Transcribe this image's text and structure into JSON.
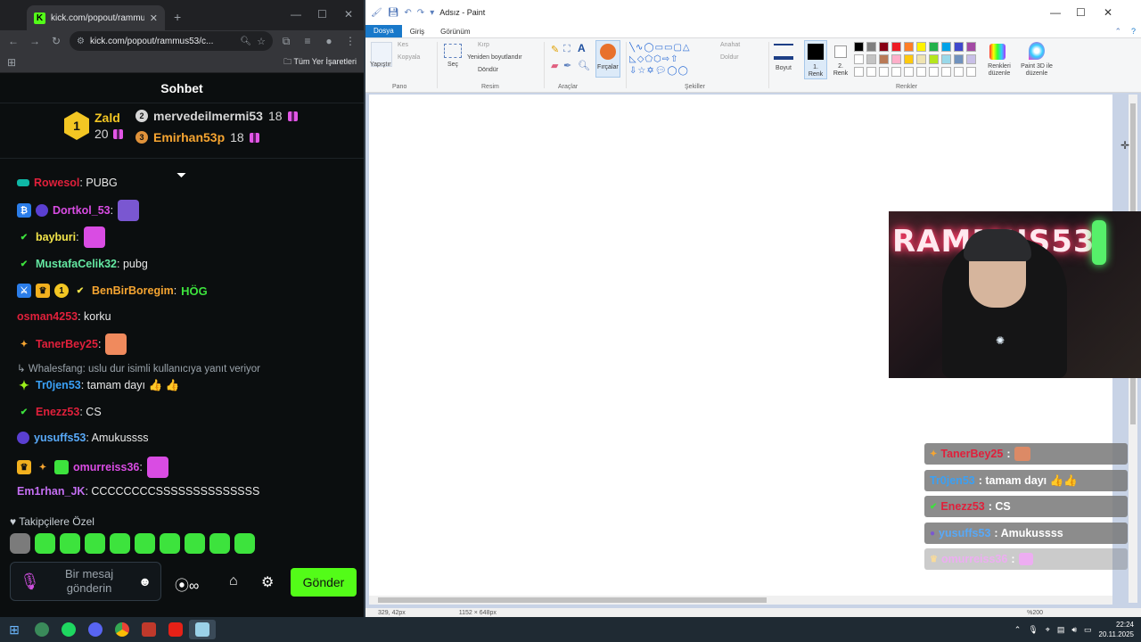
{
  "browser": {
    "tab_title": "kick.com/popout/rammus53/c",
    "url": "kick.com/popout/rammus53/c...",
    "bookmarks_label": "Tüm Yer İşaretleri"
  },
  "chat": {
    "header": "Sohbet",
    "leaderboard": {
      "first": {
        "rank": "1",
        "name": "Zald",
        "count": "20"
      },
      "second": {
        "rank": "2",
        "name": "mervedeilmermi53",
        "count": "18"
      },
      "third": {
        "rank": "3",
        "name": "Emirhan53p",
        "count": "18"
      }
    },
    "messages": [
      {
        "user": "Rowesol",
        "text": ": PUBG",
        "color": "#e0203b"
      },
      {
        "user": "Dortkol_53",
        "text": ":",
        "color": "#d94ce3"
      },
      {
        "user": "bayburi",
        "text": ":",
        "color": "#f2e44a"
      },
      {
        "user": "MustafaCelik32",
        "text": ": pubg",
        "color": "#64e8a2"
      },
      {
        "user": "BenBirBoregim",
        "text": ":",
        "color": "#f6a531"
      },
      {
        "user": "osman4253",
        "text": ": korku",
        "color": "#e0203b"
      },
      {
        "user": "TanerBey25",
        "text": ":",
        "color": "#e0203b"
      },
      {
        "user": "Tr0jen53",
        "text": ": tamam dayı 👍 👍",
        "color": "#3aa0f5"
      },
      {
        "user": "Enezz53",
        "text": ": CS",
        "color": "#e0203b"
      },
      {
        "user": "yusuffs53",
        "text": ": Amukussss",
        "color": "#58a9f8"
      },
      {
        "user": "omurreiss36",
        "text": ":",
        "color": "#d94ce3"
      },
      {
        "user": "Em1rhan_JK",
        "text": ": CCCCCCCCSSSSSSSSSSSSSS",
        "color": "#c46ef2"
      }
    ],
    "emote_text_hog": "HÖG",
    "reply_notice": "Whalesfang: uslu dur isimli kullanıcıya yanıt veriyor",
    "followers_label": "Takipçilere Özel",
    "input_placeholder": "Bir mesaj gönderin",
    "send_label": "Gönder"
  },
  "paint": {
    "title": "Adsız - Paint",
    "tabs": {
      "file": "Dosya",
      "home": "Giriş",
      "view": "Görünüm"
    },
    "clipboard": {
      "paste": "Yapıştır",
      "cut": "Kes",
      "copy": "Kopyala",
      "group": "Pano"
    },
    "image": {
      "select": "Seç",
      "crop": "Kırp",
      "resize": "Yeniden boyutlandır",
      "rotate": "Döndür",
      "group": "Resim"
    },
    "tools": {
      "group": "Araçlar",
      "brushes": "Fırçalar"
    },
    "shapes": {
      "group": "Şekiller",
      "outline": "Anahat",
      "fill": "Doldur"
    },
    "size_label": "Boyut",
    "color1": "1. Renk",
    "color2": "2. Renk",
    "colors_group": "Renkler",
    "edit_colors": "Renkleri düzenle",
    "paint3d": "Paint 3D ile düzenle",
    "status": {
      "position": "329, 42px",
      "canvas_size": "1152 × 648px",
      "zoom": "%200"
    },
    "palette": [
      "#000000",
      "#7f7f7f",
      "#880015",
      "#ed1c24",
      "#ff7f27",
      "#fff200",
      "#22b14c",
      "#00a2e8",
      "#3f48cc",
      "#a349a4",
      "#ffffff",
      "#c3c3c3",
      "#b97a57",
      "#ffaec9",
      "#ffc90e",
      "#efe4b0",
      "#b5e61d",
      "#99d9ea",
      "#7092be",
      "#c8bfe7"
    ]
  },
  "webcam": {
    "neon_text": "RAMMUS53"
  },
  "overlay": [
    {
      "user": "TanerBey25",
      "text": ":",
      "color": "#e0203b"
    },
    {
      "user": "Tr0jen53",
      "text": ": tamam dayı 👍👍",
      "color": "#3aa0f5"
    },
    {
      "user": "Enezz53",
      "text": ": CS",
      "color": "#e0203b"
    },
    {
      "user": "yusuffs53",
      "text": ": Amukussss",
      "color": "#58a9f8"
    },
    {
      "user": "omurreiss36",
      "text": ":",
      "color": "#d94ce3"
    }
  ],
  "taskbar": {
    "time": "22:24",
    "date": "20.11.2025"
  }
}
